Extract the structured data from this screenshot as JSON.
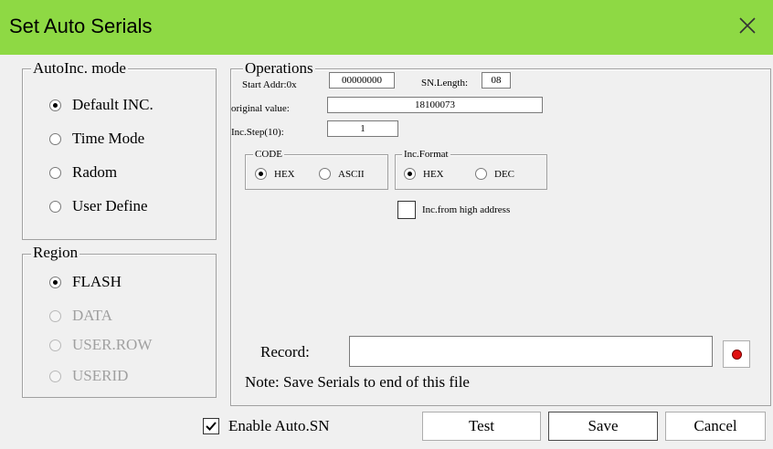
{
  "window": {
    "title": "Set Auto Serials",
    "close_icon": "close-icon"
  },
  "autoinc": {
    "legend": "AutoInc. mode",
    "options": [
      {
        "label": "Default INC.",
        "selected": true
      },
      {
        "label": "Time Mode",
        "selected": false
      },
      {
        "label": "Radom",
        "selected": false
      },
      {
        "label": "User Define",
        "selected": false
      }
    ]
  },
  "region": {
    "legend": "Region",
    "options": [
      {
        "label": "FLASH",
        "selected": true,
        "enabled": true
      },
      {
        "label": "DATA",
        "selected": false,
        "enabled": false
      },
      {
        "label": "USER.ROW",
        "selected": false,
        "enabled": false
      },
      {
        "label": "USERID",
        "selected": false,
        "enabled": false
      }
    ]
  },
  "operations": {
    "legend": "Operations",
    "start_addr_label": "Start Addr:0x",
    "start_addr_value": "00000000",
    "sn_length_label": "SN.Length:",
    "sn_length_value": "08",
    "original_value_label": "original value:",
    "original_value": "18100073",
    "inc_step_label": "Inc.Step(10):",
    "inc_step_value": "1",
    "code": {
      "legend": "CODE",
      "hex": "HEX",
      "ascii": "ASCII",
      "selected": "HEX"
    },
    "inc_format": {
      "legend": "Inc.Format",
      "hex": "HEX",
      "dec": "DEC",
      "selected": "HEX"
    },
    "inc_from_high_label": "Inc.from high address",
    "inc_from_high_checked": false,
    "record_label": "Record:",
    "record_value": "",
    "note": "Note: Save Serials to end of this file"
  },
  "footer": {
    "enable_auto_sn_label": "Enable Auto.SN",
    "enable_auto_sn_checked": true,
    "test_label": "Test",
    "save_label": "Save",
    "cancel_label": "Cancel"
  },
  "colors": {
    "titlebar": "#8ed944",
    "record_button_dot": "#e01010"
  }
}
